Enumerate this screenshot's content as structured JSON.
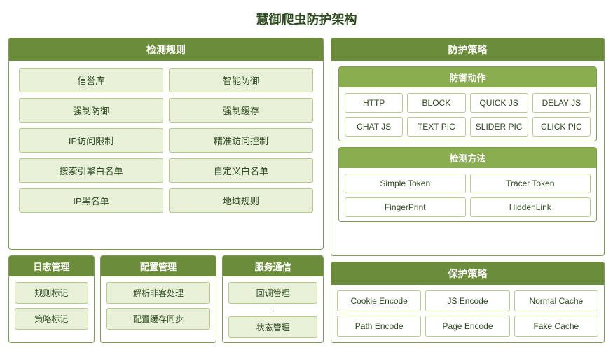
{
  "title": "慧御爬虫防护架构",
  "detection_rules": {
    "header": "检测规则",
    "items": [
      "信誉库",
      "智能防御",
      "强制防御",
      "强制缓存",
      "IP访问限制",
      "精准访问控制",
      "搜索引擎白名单",
      "自定义白名单",
      "IP黑名单",
      "地域规则"
    ]
  },
  "log_management": {
    "header": "日志管理",
    "items": [
      "规则标记",
      "策略标记"
    ]
  },
  "config_management": {
    "header": "配置管理",
    "items": [
      "解析非客处理",
      "配置缓存同步"
    ]
  },
  "service_comm": {
    "header": "服务通信",
    "items": [
      "回调管理",
      "状态管理"
    ],
    "arrow": "↓"
  },
  "defense_policy": {
    "header": "防护策略"
  },
  "defense_action": {
    "header": "防御动作",
    "row1": [
      "HTTP",
      "BLOCK",
      "QUICK JS",
      "DELAY JS"
    ],
    "row2": [
      "CHAT JS",
      "TEXT PIC",
      "SLIDER PIC",
      "CLICK PIC"
    ]
  },
  "detection_method": {
    "header": "检测方法",
    "items": [
      "Simple Token",
      "Tracer Token",
      "FingerPrint",
      "HiddenLink"
    ]
  },
  "protection_strategy": {
    "header": "保护策略",
    "items": [
      "Cookie Encode",
      "JS Encode",
      "Normal Cache",
      "Path Encode",
      "Page Encode",
      "Fake Cache"
    ]
  }
}
